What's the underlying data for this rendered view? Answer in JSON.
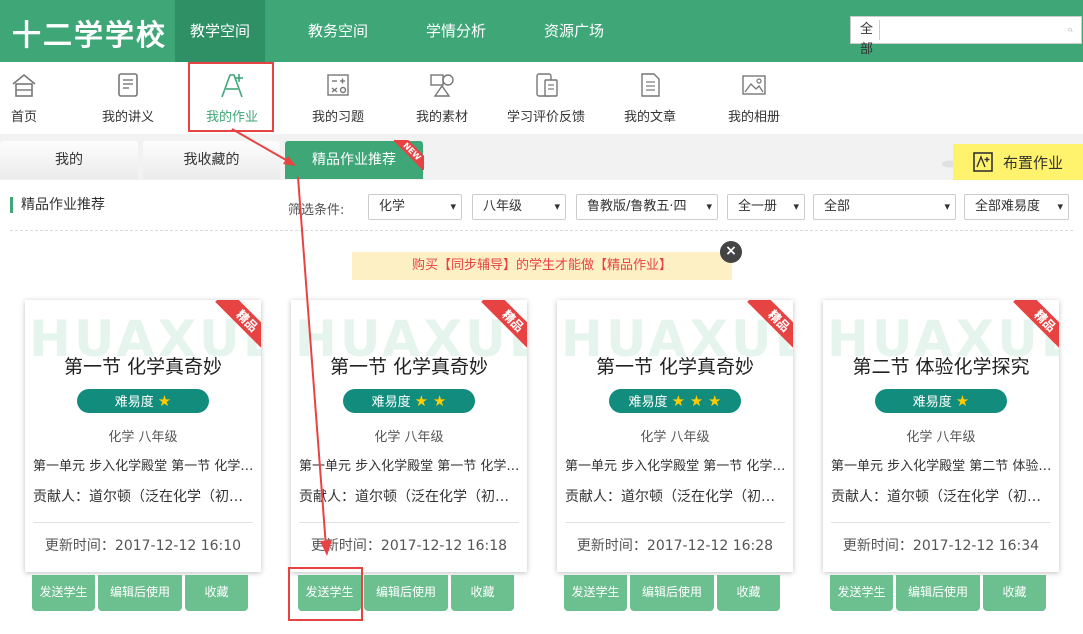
{
  "header": {
    "logo": "十二学学校",
    "nav": [
      "教学空间",
      "教务空间",
      "学情分析",
      "资源广场"
    ],
    "search": {
      "scope": "全部",
      "value": ""
    }
  },
  "modules": [
    {
      "label": "首页",
      "icon": "home-icon"
    },
    {
      "label": "我的讲义",
      "icon": "handout-icon"
    },
    {
      "label": "我的作业",
      "icon": "homework-icon"
    },
    {
      "label": "我的习题",
      "icon": "exercise-icon"
    },
    {
      "label": "我的素材",
      "icon": "material-icon"
    },
    {
      "label": "学习评价反馈",
      "icon": "feedback-icon"
    },
    {
      "label": "我的文章",
      "icon": "article-icon"
    },
    {
      "label": "我的相册",
      "icon": "album-icon"
    }
  ],
  "tabs": [
    "我的",
    "我收藏的",
    "精品作业推荐"
  ],
  "new_badge": "NEW",
  "assign_button": "布置作业",
  "section_title": "精品作业推荐",
  "filters": {
    "label": "筛选条件:",
    "values": [
      "化学",
      "八年级",
      "鲁教版/鲁教五·四",
      "全一册",
      "全部",
      "全部难易度"
    ]
  },
  "notice": "购买【同步辅导】的学生才能做【精品作业】",
  "cards": [
    {
      "watermark": "HUAXUE",
      "badge": "精品",
      "title": "第一节 化学真奇妙",
      "difficulty_label": "难易度",
      "stars": "★",
      "meta": "化学  八年级",
      "unit": "第一单元 步入化学殿堂  第一节 化学真奇妙",
      "author": "贡献人：道尔顿（泛在化学（初中））",
      "updated": "更新时间：2017-12-12 16:10"
    },
    {
      "watermark": "HUAXUE",
      "badge": "精品",
      "title": "第一节 化学真奇妙",
      "difficulty_label": "难易度",
      "stars": "★ ★",
      "meta": "化学  八年级",
      "unit": "第一单元 步入化学殿堂  第一节 化学真奇妙",
      "author": "贡献人：道尔顿（泛在化学（初中））",
      "updated": "更新时间：2017-12-12 16:18"
    },
    {
      "watermark": "HUAXUE",
      "badge": "精品",
      "title": "第一节 化学真奇妙",
      "difficulty_label": "难易度",
      "stars": "★ ★ ★",
      "meta": "化学  八年级",
      "unit": "第一单元 步入化学殿堂  第一节 化学真奇妙",
      "author": "贡献人：道尔顿（泛在化学（初中））",
      "updated": "更新时间：2017-12-12 16:28"
    },
    {
      "watermark": "HUAXUE",
      "badge": "精品",
      "title": "第二节 体验化学探究",
      "difficulty_label": "难易度",
      "stars": "★",
      "meta": "化学  八年级",
      "unit": "第一单元 步入化学殿堂  第二节 体验化学探究",
      "author": "贡献人：道尔顿（泛在化学（初中））",
      "updated": "更新时间：2017-12-12 16:34"
    }
  ],
  "card_actions": [
    "发送学生",
    "编辑后使用",
    "收藏"
  ],
  "colors": {
    "brand": "#3fa678",
    "brand_dark": "#2f9066",
    "difficulty": "#118c7d",
    "action": "#6cbf8f",
    "highlight": "#e84343",
    "assign": "#fff36d"
  }
}
